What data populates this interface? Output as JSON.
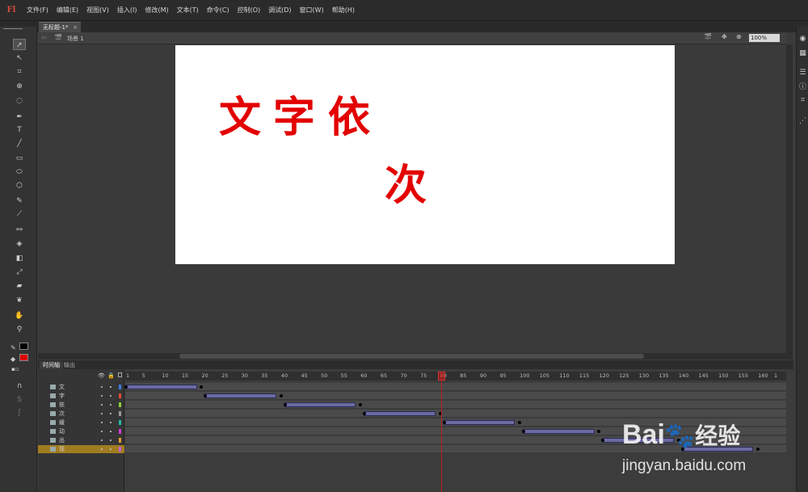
{
  "app": {
    "logo": "Fl"
  },
  "menu": [
    "文件(F)",
    "编辑(E)",
    "视图(V)",
    "插入(I)",
    "修改(M)",
    "文本(T)",
    "命令(C)",
    "控制(O)",
    "调试(D)",
    "窗口(W)",
    "帮助(H)"
  ],
  "document": {
    "tab_label": "无标题-1*",
    "close": "×"
  },
  "editbar": {
    "scene_label": "场景 1",
    "zoom": "100%"
  },
  "stage": {
    "glyphs": [
      "文",
      "字",
      "依",
      "次"
    ],
    "text_color": "#e30000",
    "background": "#ffffff"
  },
  "timeline": {
    "tabs": [
      "时间轴",
      "输出"
    ],
    "ruler_ticks": [
      "1",
      "5",
      "10",
      "15",
      "20",
      "25",
      "30",
      "35",
      "40",
      "45",
      "50",
      "55",
      "60",
      "65",
      "70",
      "75",
      "80",
      "85",
      "90",
      "95",
      "100",
      "105",
      "110",
      "115",
      "120",
      "125",
      "130",
      "135",
      "140",
      "145",
      "150",
      "155",
      "160",
      "1"
    ],
    "current_frame": 80,
    "layers": [
      {
        "name": "文",
        "color": "#3a7be0",
        "tween": [
          1,
          19
        ]
      },
      {
        "name": "字",
        "color": "#e04a3a",
        "tween": [
          21,
          39
        ]
      },
      {
        "name": "依",
        "color": "#8fcf3a",
        "tween": [
          41,
          59
        ]
      },
      {
        "name": "次",
        "color": "#9a9a9a",
        "tween": [
          61,
          79
        ]
      },
      {
        "name": "缓",
        "color": "#1fbfa0",
        "tween": [
          81,
          99
        ]
      },
      {
        "name": "动",
        "color": "#d33ad3",
        "tween": [
          101,
          119
        ]
      },
      {
        "name": "出",
        "color": "#e0a030",
        "tween": [
          121,
          139
        ]
      },
      {
        "name": "现",
        "color": "#c060e0",
        "tween": [
          141,
          159
        ],
        "selected": true
      }
    ]
  },
  "watermark": {
    "brand": "Bai",
    "brand_suffix": "经验",
    "url": "jingyan.baidu.com"
  },
  "icons": [
    "select-icon",
    "subselect-icon",
    "free-transform-icon",
    "3d-rotation-icon",
    "lasso-icon",
    "pen-icon",
    "text-icon",
    "line-icon",
    "rectangle-icon",
    "oval-icon",
    "polystar-icon",
    "pencil-icon",
    "brush-icon",
    "bone-icon",
    "paint-bucket-icon",
    "ink-bottle-icon",
    "eyedropper-icon",
    "eraser-icon",
    "deco-icon",
    "hand-icon",
    "zoom-icon",
    "stroke-color-icon",
    "fill-color-icon"
  ],
  "colors": {
    "stroke_swatch": "#000000",
    "fill_swatch": "#e00000"
  }
}
